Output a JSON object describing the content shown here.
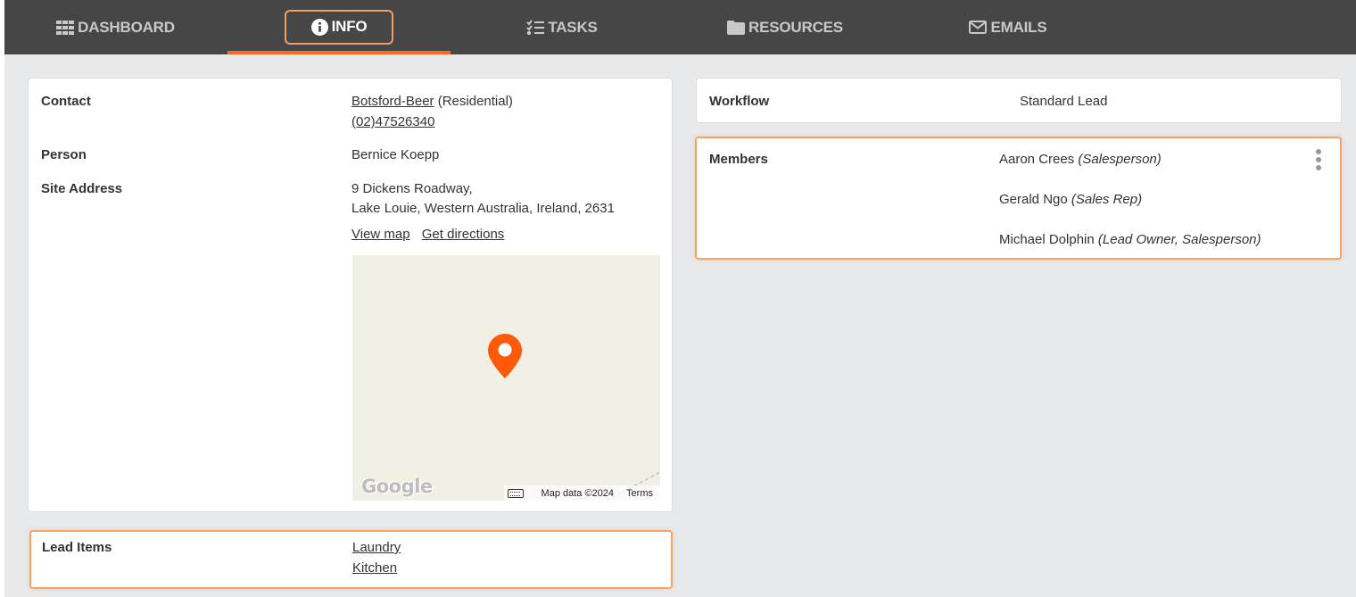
{
  "nav": {
    "tabs": [
      {
        "label": "DASHBOARD",
        "icon": "grid-icon"
      },
      {
        "label": "INFO",
        "icon": "info-circle-icon",
        "active": true
      },
      {
        "label": "TASKS",
        "icon": "checklist-icon"
      },
      {
        "label": "RESOURCES",
        "icon": "folder-icon"
      },
      {
        "label": "EMAILS",
        "icon": "envelope-icon"
      }
    ],
    "accent_color": "#ff6a1f"
  },
  "contact_card": {
    "contact_label": "Contact",
    "contact_name": "Botsford-Beer",
    "contact_type": "(Residential)",
    "contact_phone": "(02)47526340",
    "person_label": "Person",
    "person_value": "Bernice Koepp",
    "site_address_label": "Site Address",
    "address_line1": "9 Dickens Roadway,",
    "address_line2": "Lake Louie, Western Australia, Ireland, 2631",
    "view_map": "View map",
    "get_directions": "Get directions",
    "map": {
      "logo_text": "Google",
      "attribution": "Map data ©2024",
      "terms": "Terms",
      "pin_color": "#ff5a0a"
    }
  },
  "lead_items_card": {
    "label": "Lead Items",
    "items": [
      "Laundry",
      "Kitchen"
    ]
  },
  "workflow_card": {
    "label": "Workflow",
    "value": "Standard Lead"
  },
  "members_card": {
    "label": "Members",
    "members": [
      {
        "name": "Aaron Crees",
        "role": "(Salesperson)"
      },
      {
        "name": "Gerald Ngo",
        "role": "(Sales Rep)"
      },
      {
        "name": "Michael Dolphin",
        "role": "(Lead Owner, Salesperson)"
      }
    ]
  }
}
